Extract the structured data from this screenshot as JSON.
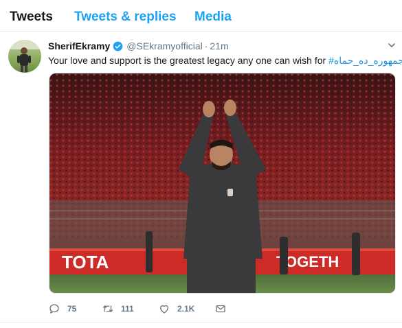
{
  "tabs": [
    {
      "label": "Tweets",
      "active": true
    },
    {
      "label": "Tweets & replies",
      "active": false
    },
    {
      "label": "Media",
      "active": false
    }
  ],
  "tweet": {
    "author_name": "SherifEkramy",
    "verified": true,
    "handle": "@SEkramyofficial",
    "separator": "·",
    "time": "21m",
    "text": "Your love and support is the greatest legacy any one can wish for",
    "hashtag": "#جمهوره_ده_حماه",
    "image_banner_left": "TOTA",
    "image_banner_right": "TOGETH",
    "counts": {
      "replies": "75",
      "retweets": "111",
      "likes": "2.1K"
    }
  },
  "icons": {
    "verified": "verified-badge-icon",
    "caret": "chevron-down-icon",
    "reply": "reply-icon",
    "retweet": "retweet-icon",
    "like": "heart-icon",
    "dm": "envelope-icon"
  },
  "colors": {
    "accent": "#1da1f2",
    "hashtag": "#1b95e0",
    "muted": "#657786",
    "text": "#14171a"
  }
}
